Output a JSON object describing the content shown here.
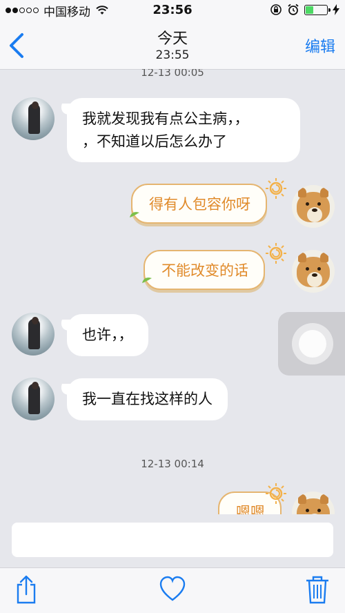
{
  "status_bar": {
    "carrier": "中国移动",
    "time": "23:56",
    "battery_level": 0.35
  },
  "nav": {
    "title": "今天",
    "subtitle": "23:55",
    "edit_label": "编辑"
  },
  "chat": {
    "timestamps": [
      "12-13 00:05",
      "12-13 00:14"
    ],
    "messages": [
      {
        "side": "left",
        "text": "我就发现我有点公主病，，\n，不知道以后怎么办了"
      },
      {
        "side": "right",
        "text": "得有人包容你呀"
      },
      {
        "side": "right",
        "text": "不能改变的话"
      },
      {
        "side": "left",
        "text": "也许，，"
      },
      {
        "side": "left",
        "text": "我一直在找这样的人"
      },
      {
        "side": "right",
        "text": "嗯嗯"
      }
    ]
  },
  "input": {
    "placeholder": ""
  },
  "toolbar": {
    "icons": [
      "share-icon",
      "heart-icon",
      "trash-icon"
    ]
  },
  "colors": {
    "accent": "#1a7cf0",
    "bubble_right_text": "#e08a2a",
    "background": "#e6e7ec"
  }
}
